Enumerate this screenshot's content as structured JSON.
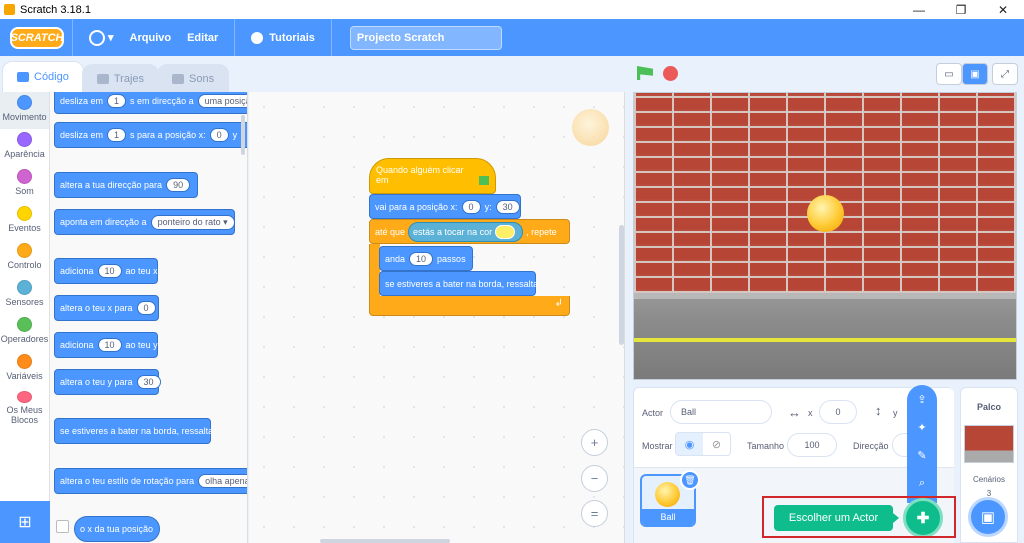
{
  "window": {
    "title": "Scratch 3.18.1",
    "minimize": "—",
    "maximize": "❐",
    "close": "✕"
  },
  "menubar": {
    "logo": "SCRATCH",
    "language_caret": "▾",
    "file": "Arquivo",
    "edit": "Editar",
    "tutorials": "Tutoriais",
    "project_title": "Projecto Scratch"
  },
  "tabs": {
    "code": "Código",
    "costumes": "Trajes",
    "sounds": "Sons"
  },
  "categories": [
    {
      "label": "Movimento",
      "color": "#4c97ff"
    },
    {
      "label": "Aparência",
      "color": "#9966ff"
    },
    {
      "label": "Som",
      "color": "#cf63cf"
    },
    {
      "label": "Eventos",
      "color": "#ffd500"
    },
    {
      "label": "Controlo",
      "color": "#ffab19"
    },
    {
      "label": "Sensores",
      "color": "#5cb1d6"
    },
    {
      "label": "Operadores",
      "color": "#59c059"
    },
    {
      "label": "Variáveis",
      "color": "#ff8c1a"
    },
    {
      "label": "Os Meus Blocos",
      "color": "#ff6680"
    }
  ],
  "palette": {
    "glide1": {
      "a": "desliza em",
      "v": "1",
      "b": "s em direcção a",
      "dd": "uma posição"
    },
    "glide2": {
      "a": "desliza em",
      "v": "1",
      "b": "s para a posição x:",
      "x": "0",
      "c": "y"
    },
    "point_dir": {
      "a": "altera a tua direcção para",
      "v": "90"
    },
    "point_towards": {
      "a": "aponta em direcção a",
      "dd": "ponteiro do rato ▾"
    },
    "change_x": {
      "a": "adiciona",
      "v": "10",
      "b": "ao teu x"
    },
    "set_x": {
      "a": "altera o teu x para",
      "v": "0"
    },
    "change_y": {
      "a": "adiciona",
      "v": "10",
      "b": "ao teu y"
    },
    "set_y": {
      "a": "altera o teu y para",
      "v": "30"
    },
    "bounce": "se estiveres a bater na borda, ressalta",
    "rotation": {
      "a": "altera o teu estilo de rotação para",
      "dd": "olha apenas"
    },
    "x_pos": "o x da tua posição"
  },
  "script": {
    "hat": "Quando alguém clicar em",
    "goto": {
      "a": "vai para a posição x:",
      "x": "0",
      "b": "y:",
      "y": "30"
    },
    "until": {
      "a": "até que",
      "cond": "estás a tocar na cor",
      "b": ", repete"
    },
    "move": {
      "a": "anda",
      "v": "10",
      "b": "passos"
    },
    "bounce": "se estiveres a bater na borda, ressalta",
    "loop_arrow": "↲"
  },
  "zoom": {
    "in": "+",
    "out": "−",
    "reset": "="
  },
  "sprite_info": {
    "actor_label": "Actor",
    "actor_name": "Ball",
    "x_label": "x",
    "x_value": "0",
    "y_label": "y",
    "show_label": "Mostrar",
    "size_label": "Tamanho",
    "size_value": "100",
    "direction_label": "Direcção"
  },
  "sprites": [
    {
      "name": "Ball"
    }
  ],
  "sprite_menu": {
    "choose_tooltip": "Escolher um Actor"
  },
  "stage_pane": {
    "header": "Palco",
    "backdrops_label": "Cenários",
    "backdrops_count": "3"
  }
}
